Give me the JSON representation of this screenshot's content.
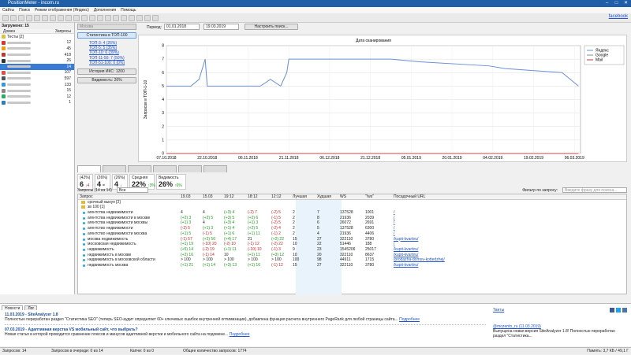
{
  "window": {
    "title": "PositionMeter - incom.ru"
  },
  "menu": [
    "Сайты",
    "Поиск",
    "Режим отображения (Яндекс)",
    "Дополнения",
    "Помощь"
  ],
  "facebook": "facebook",
  "left": {
    "header": "Загружено: 15",
    "col_domain": "Домен",
    "col_queries": "Запросы",
    "sites": [
      {
        "name": "Тесты [2]",
        "q": "",
        "color": "#e0c040"
      },
      {
        "name": "",
        "q": "12",
        "color": "#d33"
      },
      {
        "name": "",
        "q": "45",
        "color": "#f39c12"
      },
      {
        "name": "",
        "q": "418",
        "color": "#c0392b"
      },
      {
        "name": "",
        "q": "26",
        "color": "#333"
      },
      {
        "name": "",
        "q": "14",
        "color": "#2e86de"
      },
      {
        "name": "",
        "q": "107",
        "color": "#e74c3c"
      },
      {
        "name": "",
        "q": "597",
        "color": "#555"
      },
      {
        "name": "",
        "q": "133",
        "color": "#3498db"
      },
      {
        "name": "",
        "q": "15",
        "color": "#888"
      },
      {
        "name": "",
        "q": "12",
        "color": "#27ae60"
      },
      {
        "name": "",
        "q": "1",
        "color": "#2980b9"
      }
    ]
  },
  "controls": {
    "region": "Москва",
    "period_label": "Период:",
    "date_from": "01.01.2018",
    "date_to": "19.03.2019",
    "settings_btn": "Настроить поиск...",
    "stats_btn": "Статистика в ТОП-100",
    "tops": [
      "ТОП-3: 4 (26%)",
      "ТОП-5: 5 (35%)",
      "ТОП-10: 6 (39%)",
      "ТОП-11-50: 7 (50%)",
      "ТОП-51-100: 0 (0%)"
    ],
    "iks_btn": "История ИКС: 1200",
    "visibility_btn": "Видимость: 26%"
  },
  "chart_data": {
    "type": "line",
    "title": "Дата сканирования",
    "ylabel": "Запросов в ТОП-1-10",
    "ylim": [
      0,
      8
    ],
    "x_labels": [
      "07.10.2018",
      "22.10.2018",
      "06.11.2018",
      "21.11.2018",
      "06.12.2018",
      "21.12.2018",
      "05.01.2019",
      "20.01.2019",
      "04.02.2019",
      "19.02.2019",
      "06.03.2019"
    ],
    "series": [
      {
        "name": "Яндекс",
        "color": "#6a8fd8",
        "x": [
          0,
          0.25,
          0.6,
          0.8,
          0.95,
          1,
          1.75,
          2.3,
          2.55,
          2.8,
          2.95,
          3,
          5.5,
          6.2,
          7.9,
          8.3,
          9.7,
          10.1
        ],
        "values": [
          5,
          5,
          5,
          5.5,
          7,
          5,
          5,
          5,
          5.5,
          5,
          6,
          7,
          7,
          6.8,
          6.5,
          6.3,
          6,
          5
        ]
      },
      {
        "name": "Google",
        "color": "#888888",
        "x": [
          0,
          10.1
        ],
        "values": [
          0,
          0
        ]
      },
      {
        "name": "Mail",
        "color": "#cc3333",
        "x": [
          0,
          10.1
        ],
        "values": [
          0,
          0
        ]
      }
    ]
  },
  "stats": [
    {
      "a": "(42%)",
      "b": "6",
      "c": "↓4"
    },
    {
      "a": "(26%)",
      "b": "4",
      "c": "="
    },
    {
      "a": "(26%)",
      "b": "4",
      "c": "↓"
    },
    {
      "a": "Средняя",
      "b": "22%",
      "c": "↑3%"
    },
    {
      "a": "Видимость",
      "b": "26%",
      "c": "↑6%"
    }
  ],
  "grid": {
    "queries_label": "Запросы (14 из 14)",
    "filter_sel": "Все",
    "filter_label": "Фильтр по запросу:",
    "filter_placeholder": "Введите фразу для поиска...",
    "headers": [
      "Запрос",
      "19.03",
      "15.03",
      "19:12",
      "18:12",
      "12:12",
      "Лучшая",
      "Худшая",
      "WS",
      "\"!ws\"",
      "Посадочный URL"
    ],
    "groups": [
      "срочный выкуп [2]",
      "зв 100 [1]"
    ],
    "rows": [
      [
        "агентства недвижимости",
        "4",
        "4",
        "(+3) 4",
        "(-2) 7",
        "(-2) 5",
        "2",
        "7",
        "137528",
        "1001",
        "/"
      ],
      [
        "агентства недвижимости в москве",
        "(+2) 3",
        "(+2) 5",
        "(+3) 5",
        "(+2) 6",
        "(-1) 5",
        "2",
        "8",
        "21936",
        "2039",
        "/"
      ],
      [
        "агентства недвижимости москвы",
        "(+1) 3",
        "4",
        "(+3) 4",
        "(+1) 3",
        "(-2) 5",
        "2",
        "6",
        "26072",
        "2691",
        "/"
      ],
      [
        "агентство недвижимости",
        "(-2) 5",
        "(+1) 3",
        "(+1) 4",
        "(+2) 5",
        "(-2) 4",
        "2",
        "5",
        "137528",
        "6300",
        "/"
      ],
      [
        "агентство недвижимости москва",
        "(+1) 5",
        "(-1) 5",
        "(+1) 6",
        "(+1) 11",
        "(-1) 2",
        "2",
        "4",
        "21936",
        "4406",
        "/"
      ],
      [
        "москва недвижимость",
        "(-1) 57",
        "(+2) 56",
        "(+4) 17",
        "21",
        "(+2) 22",
        "15",
        "27",
        "322110",
        "3780",
        "/kupit-kvartiru/"
      ],
      [
        "московская недвижимость",
        "(+1) 19",
        "(-10) 20",
        "(-2) 10",
        "(-1) 12",
        "(-2) 22",
        "10",
        "22",
        "51446",
        "188",
        "/"
      ],
      [
        "недвижимость",
        "(+5) 14",
        "(-2) 19",
        "(+1) 11",
        "(-10) 10",
        "(-1) 3",
        "9",
        "23",
        "1545206",
        "25017",
        "/kupit-kvartiru/"
      ],
      [
        "недвижимость в москве",
        "(+2) 16",
        "(-1) 14",
        "10",
        "(+1) 11",
        "(+3) 12",
        "10",
        "20",
        "322110",
        "8637",
        "/kupit-kvartiru/"
      ],
      [
        "недвижимость в московской области",
        "> 100",
        "> 100",
        "> 100",
        "> 100",
        "> 100",
        "100",
        "98",
        "44911",
        "1715",
        "/prodazha-domov-kottedzhej/"
      ],
      [
        "недвижимость москва",
        "(+1) 21",
        "(+1) 14",
        "(+3) 13",
        "(+1) 16",
        "(-1) 12",
        "15",
        "27",
        "322110",
        "3780",
        "/kupit-kvartiru/"
      ]
    ]
  },
  "bottom": {
    "tabs": [
      "Новости",
      "Лог"
    ],
    "news": [
      {
        "title": "11.03.2019 - SiteAnalyzer 1.8",
        "text": "Полностью переработан раздел \"Статистика SEO\" (теперь SEO-аудит определяет 60+ ключевых ошибок внутренней оптимизации), добавлена функция расчета внутреннего PageRank для любой страницы сайта...",
        "more": "Подробнее"
      },
      {
        "title": "07.03.2019 - Адаптивная верстка VS мобильный сайт, что выбрать?",
        "text": "Новая статья в которой проводится сравнение плюсов и минусов адаптивной верстки и мобильного сайта на подоменe...",
        "more": "Подробнее"
      }
    ],
    "tweets_label": "Твиты",
    "tweet": {
      "user": "@mozento_ru (11.03.2019)",
      "text": "Выпущена новая версия SiteAnalyzer 1.8! Полностью переработан раздел \"Статистика..."
    }
  },
  "status": {
    "queries": "Запросов: 14",
    "queue": "Запросов в очереди: 0 из 14",
    "captcha": "Капчи: 0 из 0",
    "total": "Общее количество запросов: 1774",
    "memory": "Память: 3,7 КБ / 49,1 Г"
  }
}
